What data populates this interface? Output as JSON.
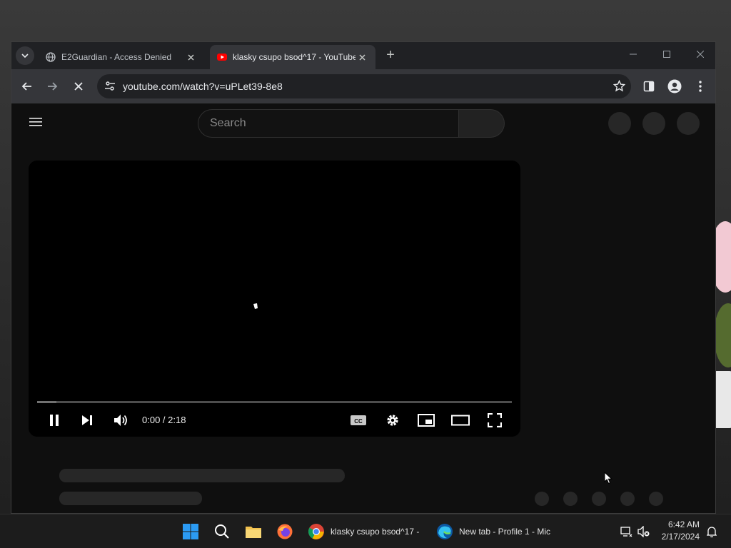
{
  "browser": {
    "tabs": [
      {
        "title": "E2Guardian - Access Denied",
        "icon": "globe-icon",
        "active": false
      },
      {
        "title": "klasky csupo bsod^17 - YouTube",
        "icon": "youtube-icon",
        "active": true
      }
    ],
    "new_tab_label": "+",
    "url": "youtube.com/watch?v=uPLet39-8e8"
  },
  "youtube": {
    "search_placeholder": "Search",
    "player": {
      "time": "0:00 / 2:18",
      "progress_fraction": 0.04
    }
  },
  "taskbar": {
    "items": [
      {
        "label": "klasky csupo bsod^17 -",
        "icon": "chrome-icon"
      },
      {
        "label": "New tab - Profile 1 - Mic",
        "icon": "edge-icon"
      }
    ],
    "clock_time": "6:42 AM",
    "clock_date": "2/17/2024"
  },
  "colors": {
    "accent_red": "#ff0000",
    "win_blue": "#1e90ff"
  }
}
